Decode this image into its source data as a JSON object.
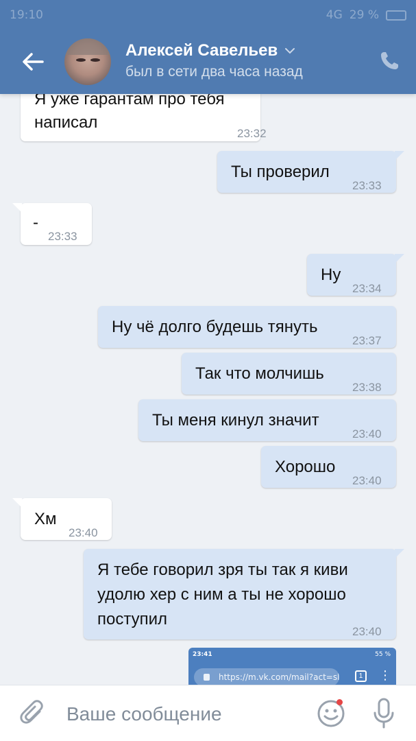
{
  "status_bar": {
    "time": "19:10",
    "network": "4G",
    "battery": "29 %"
  },
  "header": {
    "contact_name": "Алексей Савельев",
    "last_seen": "был в сети два часа назад",
    "accent_color": "#507bb1"
  },
  "messages": [
    {
      "direction": "in",
      "text_lines": [
        "Я уже гарантам про тебя",
        "написал"
      ],
      "time": "23:32"
    },
    {
      "direction": "out",
      "text": "Ты проверил",
      "time": "23:33"
    },
    {
      "direction": "in",
      "text": "-",
      "time": "23:33"
    },
    {
      "direction": "out",
      "text": "Ну",
      "time": "23:34"
    },
    {
      "direction": "out",
      "text": "Ну чё долго будешь тянуть",
      "time": "23:37"
    },
    {
      "direction": "out",
      "text": "Так что молчишь",
      "time": "23:38"
    },
    {
      "direction": "out",
      "text": "Ты меня кинул значит",
      "time": "23:40"
    },
    {
      "direction": "out",
      "text": "Хорошо",
      "time": "23:40"
    },
    {
      "direction": "in",
      "text": "Хм",
      "time": "23:40"
    },
    {
      "direction": "out",
      "text_lines": [
        "Я тебе говорил зря ты так я киви",
        "удолю хер с ним а ты не хорошо",
        "поступил"
      ],
      "time": "23:40"
    }
  ],
  "attachment": {
    "type": "screenshot",
    "time": "23:41",
    "status": "55 %",
    "url": "https://m.vk.com/mail?act=sl",
    "tab_count": "1"
  },
  "composer": {
    "placeholder": "Ваше сообщение",
    "icons": [
      "paperclip-icon",
      "smile-icon",
      "microphone-icon"
    ]
  }
}
